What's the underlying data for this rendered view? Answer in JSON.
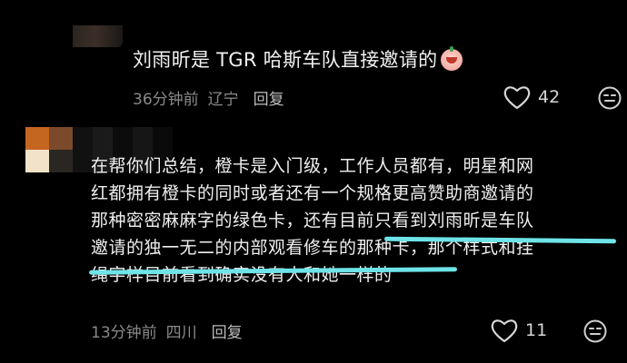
{
  "comments": [
    {
      "text": "刘雨昕是 TGR 哈斯车队直接邀请的",
      "emoji": "crying-laughing-face-emoji",
      "time": "36分钟前",
      "location": "辽宁",
      "reply": "回复",
      "likes": "42"
    },
    {
      "lines": [
        "在帮你们总结，橙卡是入门级，工作人员都有，明星和网",
        "红都拥有橙卡的同时或者还有一个规格更高赞助商邀请的",
        "那种密密麻麻字的绿色卡，还有目前只看到刘雨昕是车队",
        "邀请的独一无二的内部观看修车的那种卡，那个样式和挂",
        "绳字样目前看到确实没有人和她一样的"
      ],
      "time": "13分钟前",
      "location": "四川",
      "reply": "回复",
      "likes": "11"
    }
  ],
  "colors": {
    "background": "#000000",
    "text": "#efefef",
    "meta": "#8a8a8a",
    "highlight": "#6ee3e8"
  },
  "icons": [
    "heart-icon",
    "expressionless-face-icon"
  ]
}
